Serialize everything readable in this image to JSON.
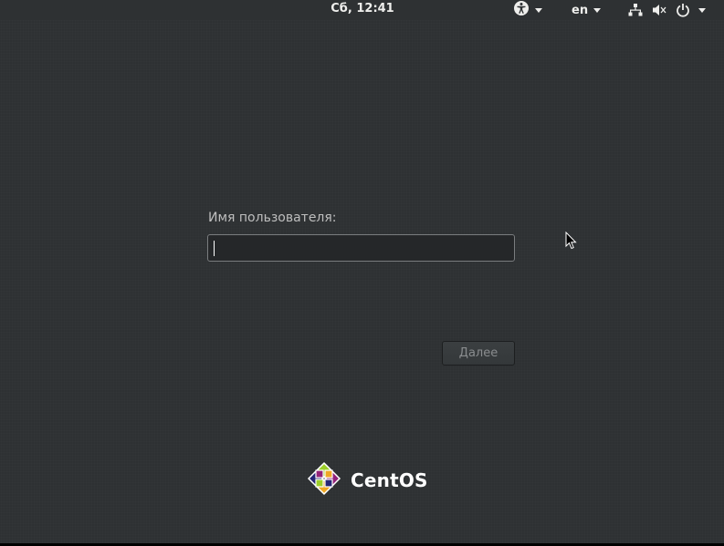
{
  "topbar": {
    "clock": "Сб, 12:41",
    "language": "en",
    "icons": {
      "accessibility": "accessibility-icon",
      "network": "network-wired-icon",
      "volume": "volume-muted-icon",
      "power": "power-icon"
    }
  },
  "login": {
    "username_label": "Имя пользователя:",
    "username_value": "",
    "next_button_label": "Далее"
  },
  "branding": {
    "logo_text": "CentOS"
  },
  "colors": {
    "background": "#2e3133",
    "text": "#eeeeec",
    "label": "#bebebe",
    "button_text_disabled": "#8a8d8f"
  }
}
